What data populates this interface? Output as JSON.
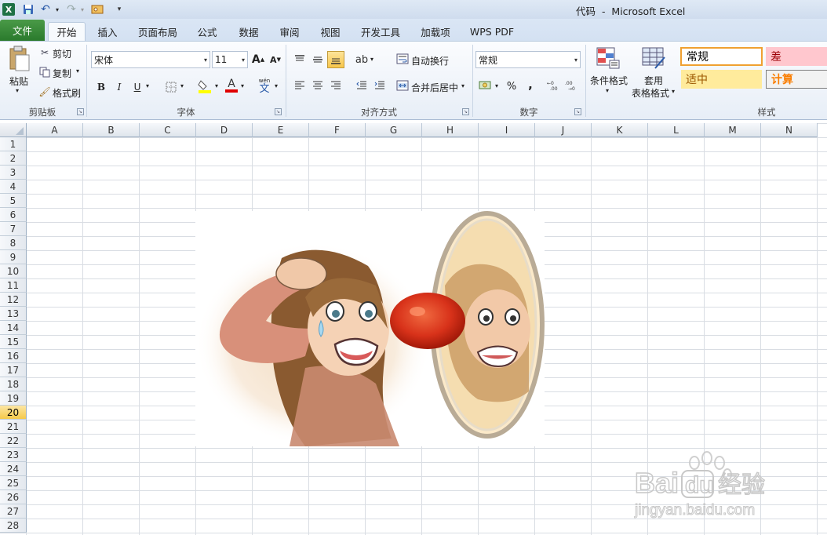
{
  "title_bar": {
    "app_logo": "X",
    "window_title": "代码  -  Microsoft Excel",
    "quick_access": [
      "save-icon",
      "undo-icon",
      "redo-icon",
      "customize-icon"
    ]
  },
  "tabs": {
    "file": "文件",
    "home": "开始",
    "insert": "插入",
    "page_layout": "页面布局",
    "formulas": "公式",
    "data": "数据",
    "review": "审阅",
    "view": "视图",
    "developer": "开发工具",
    "addins": "加载项",
    "wps_pdf": "WPS PDF"
  },
  "clipboard": {
    "paste": "粘贴",
    "cut": "剪切",
    "copy": "复制",
    "format_painter": "格式刷",
    "label": "剪贴板"
  },
  "font": {
    "name": "宋体",
    "size": "11",
    "grow": "A",
    "shrink": "A",
    "bold": "B",
    "italic": "I",
    "underline": "U",
    "font_color_glyph": "A",
    "phonetic": "wén",
    "phonetic_char": "文",
    "label": "字体"
  },
  "alignment": {
    "wrap_text": "自动换行",
    "merge_center": "合并后居中",
    "label": "对齐方式"
  },
  "number": {
    "format": "常规",
    "percent": "%",
    "comma": ",",
    "label": "数字"
  },
  "styles": {
    "conditional_formatting": "条件格式",
    "table_format_line1": "套用",
    "table_format_line2": "表格格式",
    "cells": [
      {
        "text": "常规",
        "bg": "#ffffff",
        "fg": "#000000"
      },
      {
        "text": "差",
        "bg": "#ffc7ce",
        "fg": "#9c0006"
      },
      {
        "text": "适中",
        "bg": "#ffeb9c",
        "fg": "#9c5700"
      },
      {
        "text": "计算",
        "bg": "#f2f2f2",
        "fg": "#fa7d00"
      }
    ],
    "label": "样式"
  },
  "grid": {
    "columns": [
      "A",
      "B",
      "C",
      "D",
      "E",
      "F",
      "G",
      "H",
      "I",
      "J",
      "K",
      "L",
      "M",
      "N"
    ],
    "rows": [
      "1",
      "2",
      "3",
      "4",
      "5",
      "6",
      "7",
      "8",
      "9",
      "10",
      "11",
      "12",
      "13",
      "14",
      "15",
      "16",
      "17",
      "18",
      "19",
      "20",
      "21",
      "22",
      "23",
      "24",
      "25",
      "26",
      "27",
      "28"
    ],
    "active_row": "20"
  },
  "watermark": {
    "brand": "Bai",
    "brand_du": "du",
    "brand_cn": "经验",
    "url": "jingyan.baidu.com"
  },
  "colors": {
    "file_tab": "#2a7a2c",
    "active_row_header": "#f5c94a",
    "ribbon_bg": "#e7eef7"
  }
}
